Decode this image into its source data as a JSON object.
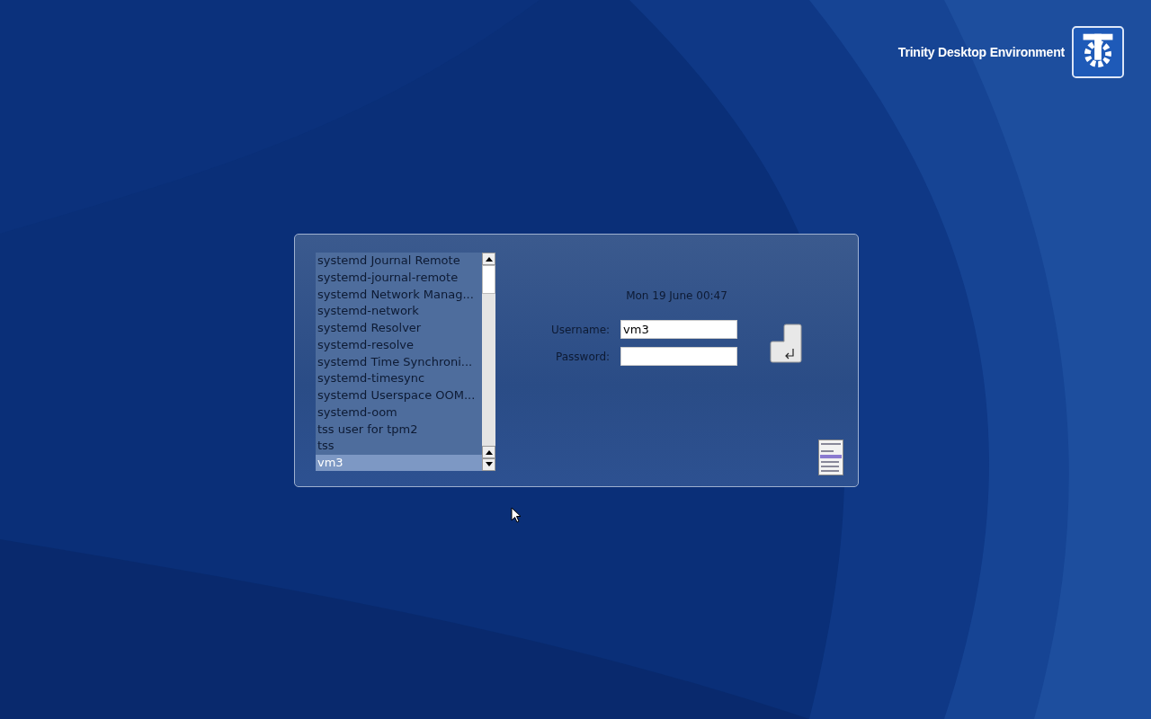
{
  "branding": {
    "title": "Trinity Desktop Environment"
  },
  "user_list": {
    "items": [
      {
        "label": "systemd Journal Remote",
        "selected": false
      },
      {
        "label": "systemd-journal-remote",
        "selected": false
      },
      {
        "label": "systemd Network Manag...",
        "selected": false
      },
      {
        "label": "systemd-network",
        "selected": false
      },
      {
        "label": "systemd Resolver",
        "selected": false
      },
      {
        "label": "systemd-resolve",
        "selected": false
      },
      {
        "label": "systemd Time Synchroni...",
        "selected": false
      },
      {
        "label": "systemd-timesync",
        "selected": false
      },
      {
        "label": "systemd Userspace OOM...",
        "selected": false
      },
      {
        "label": "systemd-oom",
        "selected": false
      },
      {
        "label": "tss user for tpm2",
        "selected": false
      },
      {
        "label": "tss",
        "selected": false
      },
      {
        "label": "vm3",
        "selected": true
      }
    ]
  },
  "clock": "Mon 19 June 00:47",
  "form": {
    "username_label": "Username:",
    "username": "vm3",
    "password_label": "Password:"
  }
}
